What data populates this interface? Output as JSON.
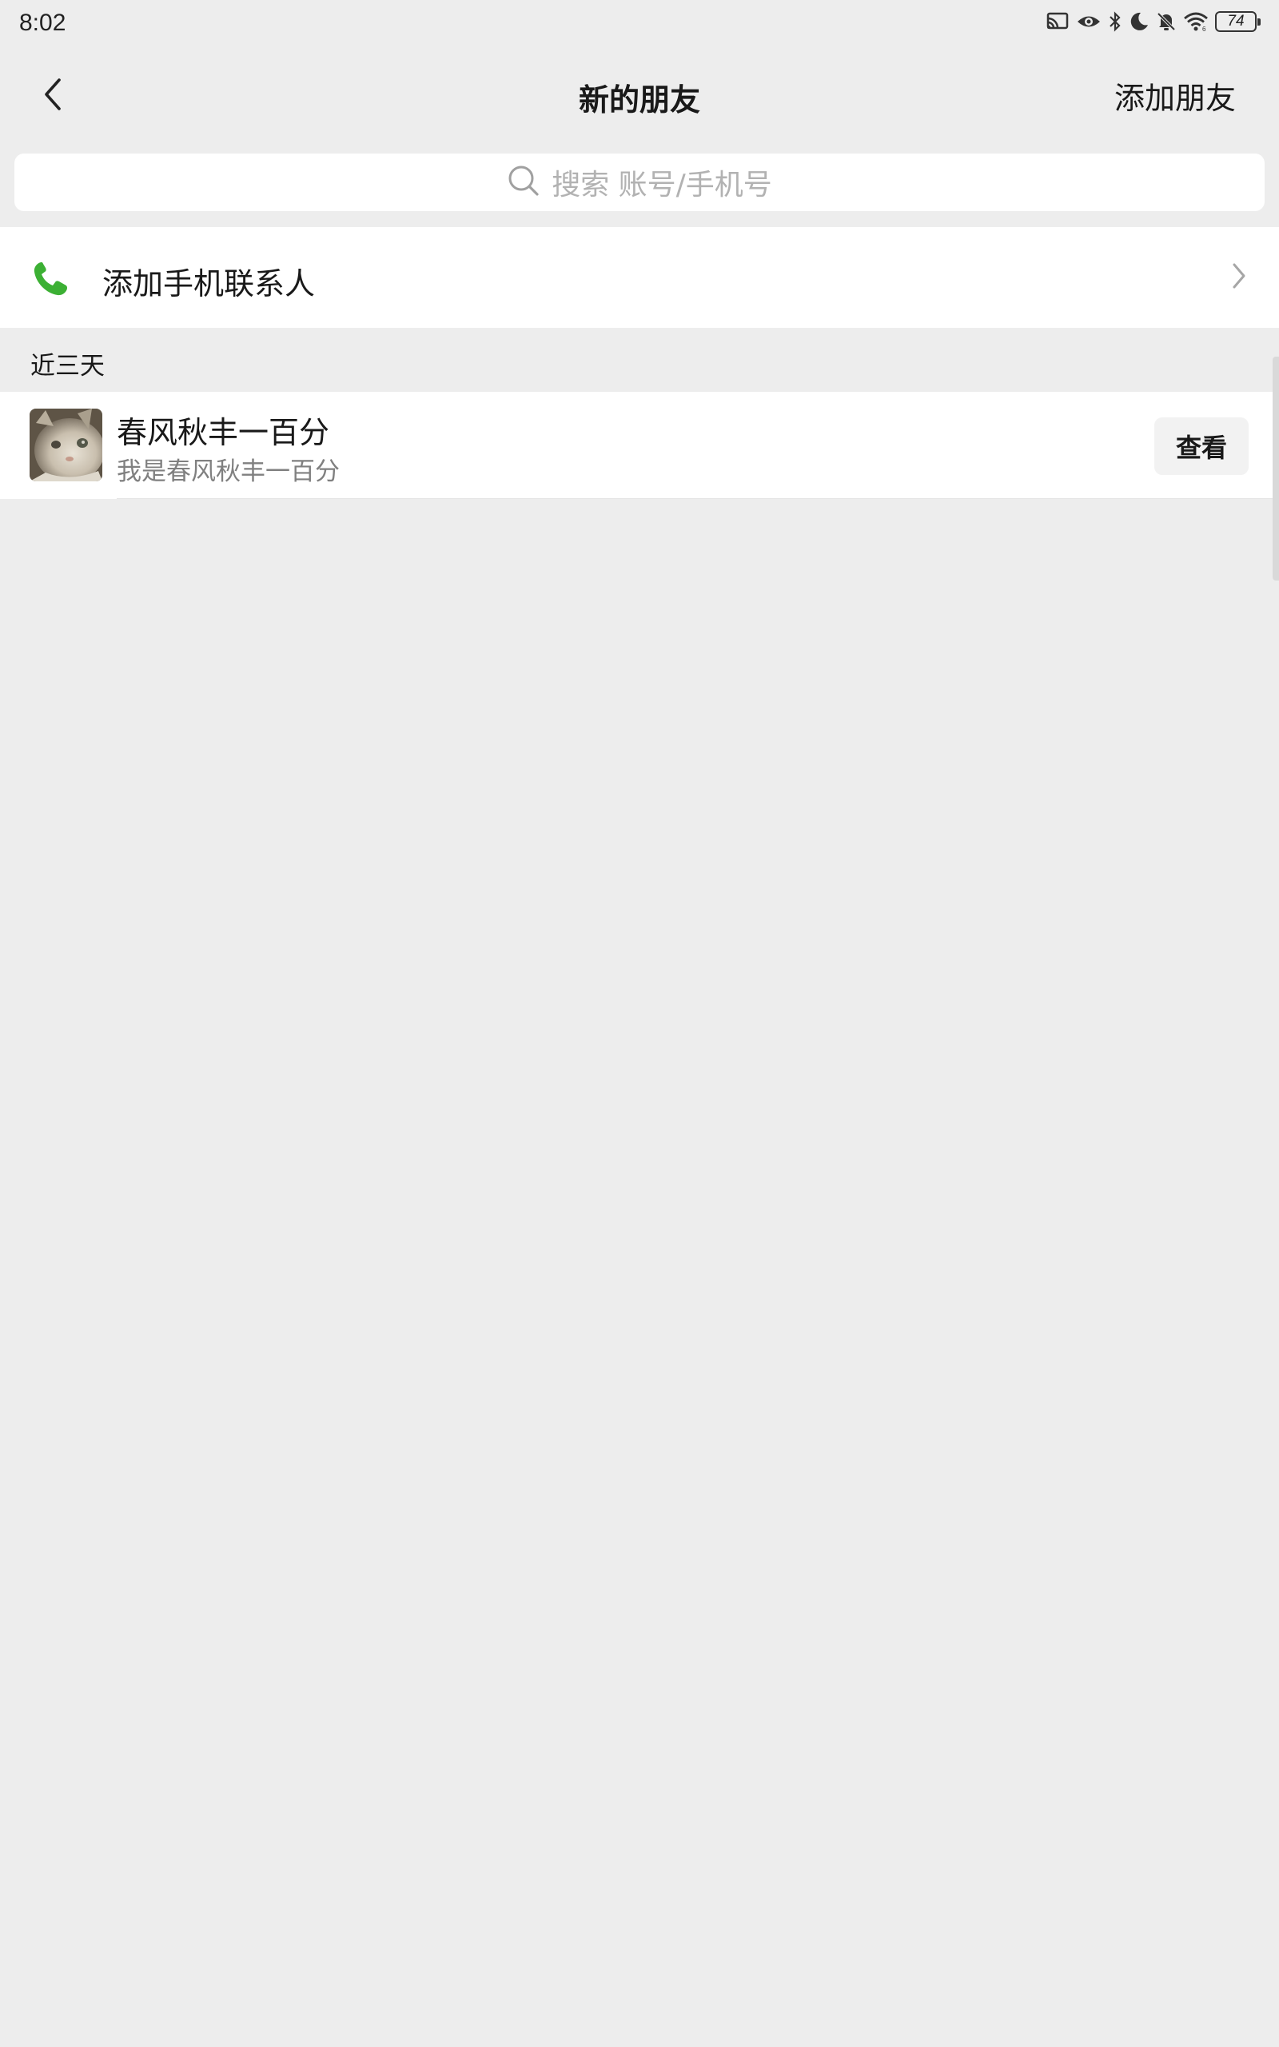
{
  "status_bar": {
    "time": "8:02",
    "battery": "74",
    "icons": [
      "cast-icon",
      "eye-icon",
      "bluetooth-icon",
      "moon-icon",
      "bell-off-icon",
      "wifi-icon",
      "battery-icon"
    ]
  },
  "nav": {
    "back_icon": "chevron-left-icon",
    "title": "新的朋友",
    "action_label": "添加朋友"
  },
  "search": {
    "icon": "search-icon",
    "placeholder": "搜索 账号/手机号"
  },
  "phone_contacts": {
    "icon": "phone-icon",
    "label": "添加手机联系人",
    "accent_color": "#3cb034"
  },
  "recent_section": {
    "label": "近三天",
    "items": [
      {
        "name": "春风秋丰一百分",
        "message": "我是春风秋丰一百分",
        "button_label": "查看"
      }
    ]
  }
}
